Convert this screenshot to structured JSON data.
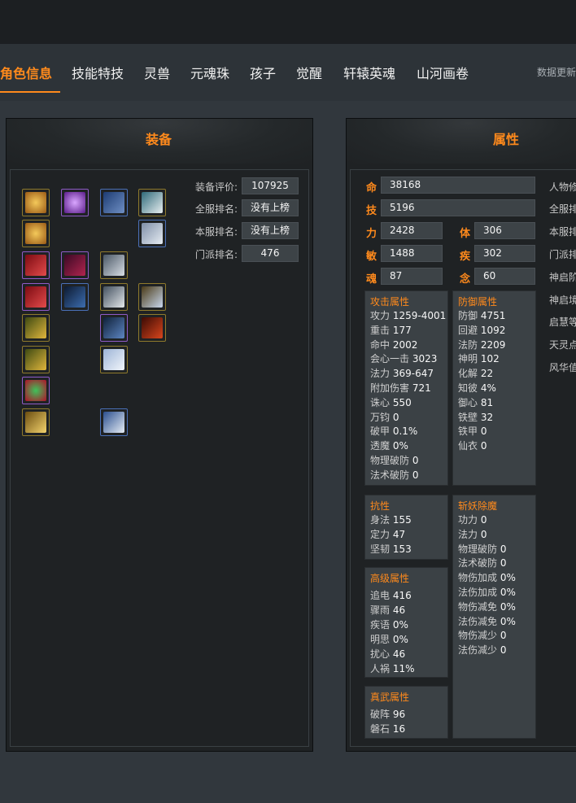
{
  "tabs": [
    {
      "label": "角色信息",
      "active": true
    },
    {
      "label": "技能特技"
    },
    {
      "label": "灵兽"
    },
    {
      "label": "元魂珠"
    },
    {
      "label": "孩子"
    },
    {
      "label": "觉醒"
    },
    {
      "label": "轩辕英魂"
    },
    {
      "label": "山河画卷"
    }
  ],
  "update_label": "数据更新",
  "equipment": {
    "title": "装备",
    "rating_label": "装备评价:",
    "rating_value": "107925",
    "server_all_label": "全服排名:",
    "server_all_value": "没有上榜",
    "server_local_label": "本服排名:",
    "server_local_value": "没有上榜",
    "sect_label": "门派排名:",
    "sect_value": "476",
    "slots": [
      {
        "icon": "gold-medallion-icon"
      },
      {
        "icon": "purple-orb-icon"
      },
      {
        "icon": "blue-armor-icon"
      },
      {
        "icon": "white-crane-icon"
      },
      {
        "icon": "gold-medallion-icon"
      },
      {
        "icon": "silver-armor-icon"
      },
      {
        "icon": "red-cape-icon"
      },
      {
        "icon": "crimson-hair-icon"
      },
      {
        "icon": "silver-helm-icon"
      },
      {
        "icon": "red-cape-icon"
      },
      {
        "icon": "dark-blade-icon"
      },
      {
        "icon": "silver-mecha-icon"
      },
      {
        "icon": "crane-helm-icon"
      },
      {
        "icon": "gold-bracelet-icon"
      },
      {
        "icon": "blue-blade-icon"
      },
      {
        "icon": "fire-blade-icon"
      },
      {
        "icon": "gold-bracelet-icon"
      },
      {
        "icon": "white-pants-icon"
      },
      {
        "icon": "ruby-amulet-icon"
      },
      {
        "icon": "gold-belt-icon"
      },
      {
        "icon": "silver-boots-icon"
      }
    ]
  },
  "attributes": {
    "title": "属性",
    "ming_label": "命",
    "ming_value": "38168",
    "ji_label": "技",
    "ji_value": "5196",
    "li_label": "力",
    "li_value": "2428",
    "ti_label": "体",
    "ti_value": "306",
    "min_label": "敏",
    "min_value": "1488",
    "ji2_label": "疾",
    "ji2_value": "302",
    "hun_label": "魂",
    "hun_value": "87",
    "nian_label": "念",
    "nian_value": "60",
    "attack": {
      "title": "攻击属性",
      "rows": [
        {
          "k": "攻力",
          "v": "1259-4001"
        },
        {
          "k": "重击",
          "v": "177"
        },
        {
          "k": "命中",
          "v": "2002"
        },
        {
          "k": "会心一击",
          "v": "3023"
        },
        {
          "k": "法力",
          "v": "369-647"
        },
        {
          "k": "附加伤害",
          "v": "721"
        },
        {
          "k": "诛心",
          "v": "550"
        },
        {
          "k": "万钧",
          "v": "0"
        },
        {
          "k": "破甲",
          "v": "0.1%"
        },
        {
          "k": "透魔",
          "v": "0%"
        },
        {
          "k": "物理破防",
          "v": "0"
        },
        {
          "k": "法术破防",
          "v": "0"
        }
      ]
    },
    "defense": {
      "title": "防御属性",
      "rows": [
        {
          "k": "防御",
          "v": "4751"
        },
        {
          "k": "回避",
          "v": "1092"
        },
        {
          "k": "法防",
          "v": "2209"
        },
        {
          "k": "神明",
          "v": "102"
        },
        {
          "k": "化解",
          "v": "22"
        },
        {
          "k": "知彼",
          "v": "4%"
        },
        {
          "k": "御心",
          "v": "81"
        },
        {
          "k": "铁壁",
          "v": "32"
        },
        {
          "k": "铁甲",
          "v": "0"
        },
        {
          "k": "仙衣",
          "v": "0"
        }
      ]
    },
    "resist": {
      "title": "抗性",
      "rows": [
        {
          "k": "身法",
          "v": "155"
        },
        {
          "k": "定力",
          "v": "47"
        },
        {
          "k": "坚韧",
          "v": "153"
        }
      ]
    },
    "demon": {
      "title": "斩妖除魔",
      "rows": [
        {
          "k": "功力",
          "v": "0"
        },
        {
          "k": "法力",
          "v": "0"
        },
        {
          "k": "物理破防",
          "v": "0"
        },
        {
          "k": "法术破防",
          "v": "0"
        },
        {
          "k": "物伤加成",
          "v": "0%"
        },
        {
          "k": "法伤加成",
          "v": "0%"
        },
        {
          "k": "物伤减免",
          "v": "0%"
        },
        {
          "k": "法伤减免",
          "v": "0%"
        },
        {
          "k": "物伤减少",
          "v": "0"
        },
        {
          "k": "法伤减少",
          "v": "0"
        }
      ]
    },
    "advanced": {
      "title": "高级属性",
      "rows": [
        {
          "k": "追电",
          "v": "416"
        },
        {
          "k": "骤雨",
          "v": "46"
        },
        {
          "k": "疾语",
          "v": "0%"
        },
        {
          "k": "明思",
          "v": "0%"
        },
        {
          "k": "扰心",
          "v": "46"
        },
        {
          "k": "人祸",
          "v": "11%"
        }
      ]
    },
    "zhenwu": {
      "title": "真武属性",
      "rows": [
        {
          "k": "破阵",
          "v": "96"
        },
        {
          "k": "磐石",
          "v": "16"
        }
      ]
    }
  },
  "side_labels": [
    "人物修",
    "全服排",
    "本服排",
    "门派排",
    "神启阶",
    "神启境",
    "启慧等",
    "天灵点",
    "风华值"
  ]
}
